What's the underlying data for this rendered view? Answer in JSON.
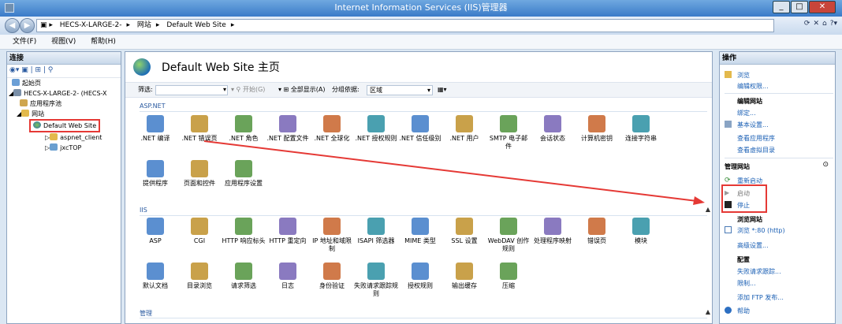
{
  "title": "Internet Information Services (IIS)管理器",
  "window_buttons": [
    "_",
    "□",
    "✕"
  ],
  "address": [
    "HECS-X-LARGE-2-",
    "网站",
    "Default Web Site"
  ],
  "menu": [
    "文件(F)",
    "视图(V)",
    "帮助(H)"
  ],
  "left": {
    "header": "连接",
    "tree": [
      "起始页",
      "HECS-X-LARGE-2- (HECS-X",
      "应用程序池",
      "网站",
      "Default Web Site",
      "aspnet_client",
      "jxcTOP"
    ]
  },
  "center": {
    "title": "Default Web Site 主页",
    "filter": {
      "label": "筛选:",
      "start": "开始(G)",
      "showall": "全部显示(A)",
      "groupby": "分组依据:",
      "groupval": "区域"
    },
    "groups": [
      "ASP.NET",
      "IIS",
      "管理"
    ],
    "aspnet": [
      ".NET 编译",
      ".NET 错误页",
      ".NET 角色",
      ".NET 配置文件",
      ".NET 全球化",
      ".NET 授权规则",
      ".NET 信任级别",
      ".NET 用户",
      "SMTP 电子邮件",
      "会话状态",
      "计算机密钥",
      "连接字符串"
    ],
    "aspnet2": [
      "提供程序",
      "页面和控件",
      "应用程序设置"
    ],
    "iis1": [
      "ASP",
      "CGI",
      "HTTP 响应标头",
      "HTTP 重定向",
      "IP 地址和域限制",
      "ISAPI 筛选器",
      "MIME 类型",
      "SSL 设置",
      "WebDAV 创作规则",
      "处理程序映射",
      "错误页",
      "模块"
    ],
    "iis2": [
      "默认文档",
      "目录浏览",
      "请求筛选",
      "日志",
      "身份验证",
      "失败请求跟踪规则",
      "授权规则",
      "输出缓存",
      "压缩"
    ]
  },
  "right": {
    "header": "操作",
    "browse": "浏览",
    "edit_perm": "编辑权限...",
    "edit_site": "编辑网站",
    "bind": "绑定...",
    "basic": "基本设置...",
    "view_apps": "查看应用程序",
    "view_vdirs": "查看虚拟目录",
    "manage": "管理网站",
    "restart": "重新启动",
    "start": "启动",
    "stop": "停止",
    "browse_site": "浏览网站",
    "browse80": "浏览 *:80 (http)",
    "advanced": "高级设置...",
    "config": "配置",
    "failed": "失败请求跟踪...",
    "limits": "限制...",
    "ftp": "添加 FTP 发布...",
    "help": "帮助"
  }
}
